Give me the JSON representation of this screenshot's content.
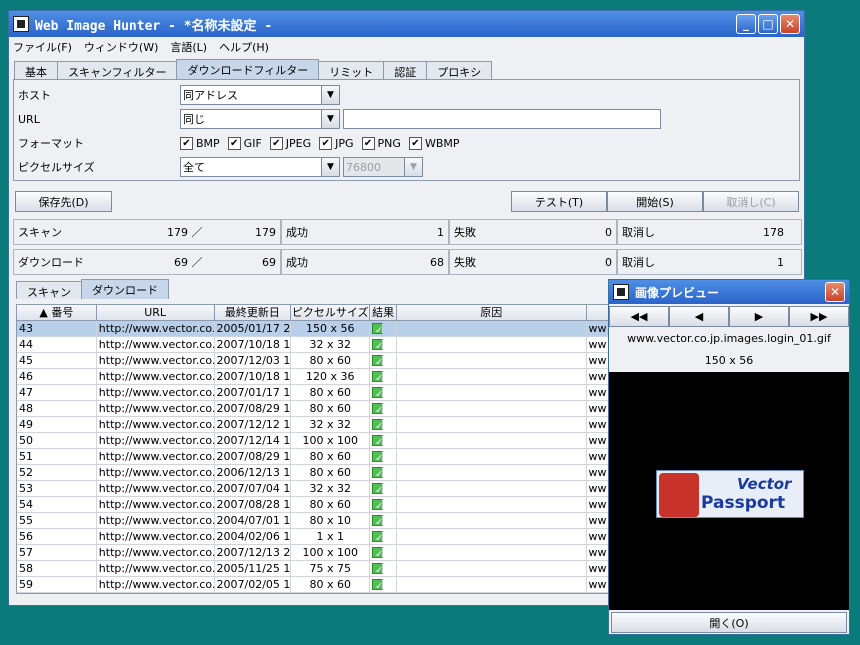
{
  "main": {
    "title": "Web Image Hunter  - *名称未設定 -",
    "menu": [
      "ファイル(F)",
      "ウィンドウ(W)",
      "言語(L)",
      "ヘルプ(H)"
    ],
    "tabs": [
      "基本",
      "スキャンフィルター",
      "ダウンロードフィルター",
      "リミット",
      "認証",
      "プロキシ"
    ],
    "active_tab": 2,
    "filters": {
      "host_label": "ホスト",
      "host_value": "同アドレス",
      "url_label": "URL",
      "url_value": "同じ",
      "url_text": "",
      "format_label": "フォーマット",
      "formats": [
        "BMP",
        "GIF",
        "JPEG",
        "JPG",
        "PNG",
        "WBMP"
      ],
      "pixel_label": "ピクセルサイズ",
      "pixel_value": "全て",
      "pixel_value2": "76800"
    },
    "buttons": {
      "save": "保存先(D)",
      "test": "テスト(T)",
      "start": "開始(S)",
      "cancel": "取消し(C)"
    },
    "stats": {
      "scan": {
        "label": "スキャン",
        "current": "179",
        "sep": "／",
        "total": "179"
      },
      "download": {
        "label": "ダウンロード",
        "current": "69",
        "sep": "／",
        "total": "69"
      },
      "row1": {
        "success_label": "成功",
        "success": "1",
        "fail_label": "失敗",
        "fail": "0",
        "cancel_label": "取消し",
        "cancel": "178"
      },
      "row2": {
        "success_label": "成功",
        "success": "68",
        "fail_label": "失敗",
        "fail": "0",
        "cancel_label": "取消し",
        "cancel": "1"
      }
    },
    "subtabs": [
      "スキャン",
      "ダウンロード"
    ],
    "columns": [
      "▲ 番号",
      "URL",
      "最終更新日",
      "ピクセルサイズ",
      "結果",
      "原因",
      ""
    ],
    "rows": [
      [
        "43",
        "http://www.vector.co...",
        "2005/01/17 2...",
        "150 x 56",
        "ww"
      ],
      [
        "44",
        "http://www.vector.co...",
        "2007/10/18 1...",
        "32 x 32",
        "ww"
      ],
      [
        "45",
        "http://www.vector.co...",
        "2007/12/03 1...",
        "80 x 60",
        "ww"
      ],
      [
        "46",
        "http://www.vector.co...",
        "2007/10/18 1...",
        "120 x 36",
        "ww"
      ],
      [
        "47",
        "http://www.vector.co...",
        "2007/01/17 1...",
        "80 x 60",
        "ww"
      ],
      [
        "48",
        "http://www.vector.co...",
        "2007/08/29 1...",
        "80 x 60",
        "ww"
      ],
      [
        "49",
        "http://www.vector.co...",
        "2007/12/12 1...",
        "32 x 32",
        "ww"
      ],
      [
        "50",
        "http://www.vector.co...",
        "2007/12/14 1...",
        "100 x 100",
        "ww"
      ],
      [
        "51",
        "http://www.vector.co...",
        "2007/08/29 1...",
        "80 x 60",
        "ww"
      ],
      [
        "52",
        "http://www.vector.co...",
        "2006/12/13 1...",
        "80 x 60",
        "ww"
      ],
      [
        "53",
        "http://www.vector.co...",
        "2007/07/04 1...",
        "32 x 32",
        "ww"
      ],
      [
        "54",
        "http://www.vector.co...",
        "2007/08/28 1...",
        "80 x 60",
        "ww"
      ],
      [
        "55",
        "http://www.vector.co...",
        "2004/07/01 1...",
        "80 x 10",
        "ww"
      ],
      [
        "56",
        "http://www.vector.co...",
        "2004/02/06 1...",
        "1 x 1",
        "ww"
      ],
      [
        "57",
        "http://www.vector.co...",
        "2007/12/13 2...",
        "100 x 100",
        "ww"
      ],
      [
        "58",
        "http://www.vector.co...",
        "2005/11/25 1...",
        "75 x 75",
        "ww"
      ],
      [
        "59",
        "http://www.vector.co...",
        "2007/02/05 1...",
        "80 x 60",
        "ww"
      ]
    ]
  },
  "preview": {
    "title": "画像プレビュー",
    "nav": [
      "◀◀",
      "◀",
      "▶",
      "▶▶"
    ],
    "filename": "www.vector.co.jp.images.login_01.gif",
    "size": "150 x 56",
    "logo_top": "Vector",
    "logo_bottom": "Passport",
    "open_button": "開く(O)"
  }
}
